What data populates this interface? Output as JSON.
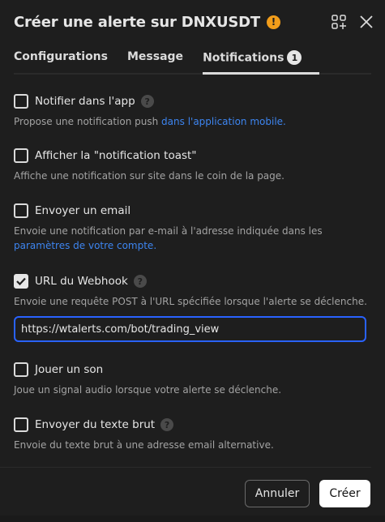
{
  "dialog": {
    "title": "Créer une alerte sur DNXUSDT",
    "warning_glyph": "!",
    "icons": [
      "add-widget-icon",
      "close-icon"
    ]
  },
  "tabs": [
    {
      "label": "Configurations"
    },
    {
      "label": "Message"
    },
    {
      "label": "Notifications",
      "badge": "1",
      "active": true
    }
  ],
  "options": {
    "app": {
      "label": "Notifier dans l'app",
      "checked": false,
      "desc": "Propose une notification push ",
      "desc_link": "dans l'application mobile."
    },
    "toast": {
      "label": "Afficher la \"notification toast\"",
      "checked": false,
      "desc": "Affiche une notification sur site dans le coin de la page."
    },
    "email": {
      "label": "Envoyer un email",
      "checked": false,
      "desc": "Envoie une notification par e-mail à l'adresse indiquée dans les",
      "desc_link": "paramètres de votre compte."
    },
    "webhook": {
      "label": "URL du Webhook",
      "checked": true,
      "desc": "Envoie une requête POST à l'URL spécifiée lorsque l'alerte se déclenche.",
      "url_value": "https://wtalerts.com/bot/trading_view"
    },
    "sound": {
      "label": "Jouer un son",
      "checked": false,
      "desc": "Joue un signal audio lorsque votre alerte se déclenche."
    },
    "plain": {
      "label": "Envoyer du texte brut",
      "checked": false,
      "desc": "Envoie du texte brut à une adresse email alternative."
    }
  },
  "help_glyph": "?",
  "footer": {
    "cancel_label": "Annuler",
    "create_label": "Créer"
  },
  "colors": {
    "background": "#1e1e1e",
    "link": "#3d85f0",
    "focus_border": "#2962ff",
    "warning": "#f29d1a"
  }
}
